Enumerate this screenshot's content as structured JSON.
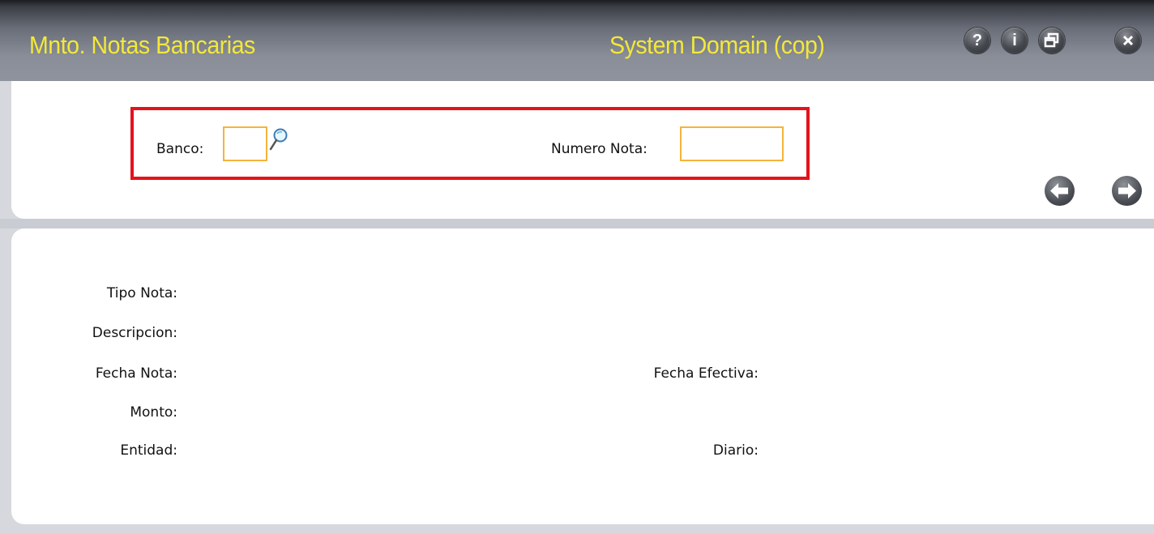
{
  "window": {
    "title": "Mnto. Notas Bancarias",
    "domain": "System Domain (cop)",
    "buttons": {
      "help": "?",
      "info": "i"
    }
  },
  "search": {
    "banco_label": "Banco:",
    "banco_value": "",
    "numero_nota_label": "Numero Nota:",
    "numero_nota_value": ""
  },
  "details": {
    "tipo_nota_label": "Tipo Nota:",
    "descripcion_label": "Descripcion:",
    "fecha_nota_label": "Fecha Nota:",
    "fecha_efectiva_label": "Fecha Efectiva:",
    "monto_label": "Monto:",
    "entidad_label": "Entidad:",
    "diario_label": "Diario:"
  },
  "colors": {
    "title_text": "#f3e83a",
    "highlight_border": "#e5121b",
    "field_border": "#f5b43a"
  },
  "icons": [
    "help-icon",
    "info-icon",
    "restore-window-icon",
    "close-icon",
    "magnifier-icon",
    "arrow-left-icon",
    "arrow-right-icon"
  ]
}
